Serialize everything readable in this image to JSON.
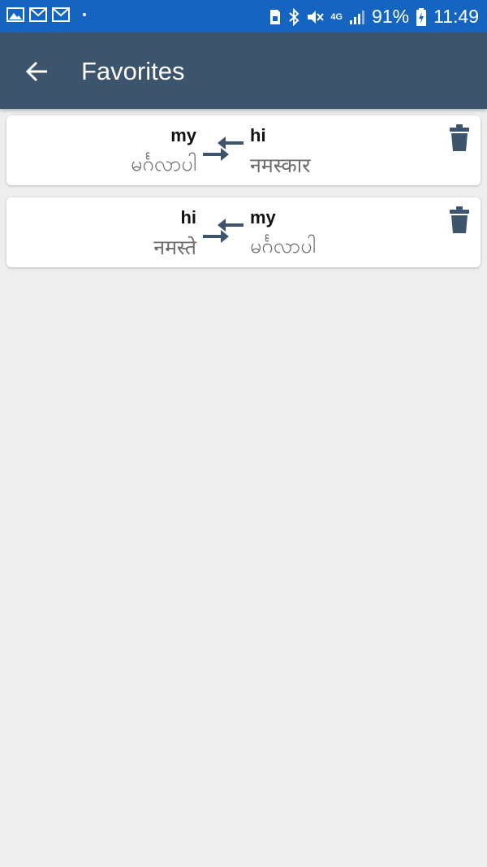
{
  "status_bar": {
    "battery": "91%",
    "time": "11:49",
    "network": "4G",
    "icons": [
      "gallery-icon",
      "gmail-icon",
      "gmail-icon",
      "sim-icon",
      "bluetooth-icon",
      "mute-icon",
      "signal-icon",
      "battery-icon"
    ]
  },
  "app_bar": {
    "title": "Favorites",
    "back_icon": "arrow-back-icon"
  },
  "favorites": [
    {
      "src_lang": "my",
      "src_text": "မင်္ဂလာပါ",
      "dst_lang": "hi",
      "dst_text": "नमस्कार"
    },
    {
      "src_lang": "hi",
      "src_text": "नमस्ते",
      "dst_lang": "my",
      "dst_text": "မင်္ဂလာပါ"
    }
  ],
  "colors": {
    "status_bar": "#1565c0",
    "app_bar": "#3d546d",
    "background": "#eeeeee",
    "icon": "#3d546d"
  }
}
